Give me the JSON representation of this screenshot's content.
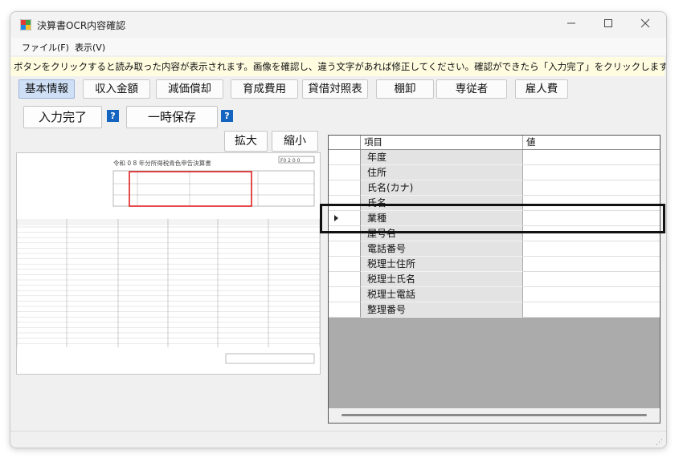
{
  "window": {
    "title": "決算書OCR内容確認"
  },
  "menu": [
    "ファイル(F)",
    "表示(V)"
  ],
  "instruction": "ボタンをクリックすると読み取った内容が表示されます。画像を確認し、違う文字があれば修正してください。確認ができたら「入力完了」をクリックします。",
  "tabs": [
    {
      "label": "基本情報",
      "active": true
    },
    {
      "label": "収入金額"
    },
    {
      "label": "減価償却"
    },
    {
      "label": "育成費用"
    },
    {
      "label": "貸借対照表"
    },
    {
      "label": "棚卸"
    },
    {
      "label": "専従者"
    },
    {
      "label": "雇人費"
    }
  ],
  "actions": {
    "complete": "入力完了",
    "save": "一時保存",
    "help": "?"
  },
  "zoom": {
    "in": "拡大",
    "out": "縮小"
  },
  "document": {
    "heading": "令和 0 8 年分所得税青色申告決算書",
    "page_number": "F0 2 0 0"
  },
  "grid": {
    "columns": [
      "項目",
      "値"
    ],
    "rows": [
      {
        "item": "年度",
        "value": ""
      },
      {
        "item": "住所",
        "value": ""
      },
      {
        "item": "氏名(カナ)",
        "value": ""
      },
      {
        "item": "氏名",
        "value": ""
      },
      {
        "item": "業種",
        "value": "",
        "current": true
      },
      {
        "item": "屋号名",
        "value": ""
      },
      {
        "item": "電話番号",
        "value": ""
      },
      {
        "item": "税理士住所",
        "value": ""
      },
      {
        "item": "税理士氏名",
        "value": ""
      },
      {
        "item": "税理士電話",
        "value": ""
      },
      {
        "item": "整理番号",
        "value": ""
      }
    ]
  },
  "colors": {
    "help_badge": "#1565c0",
    "active_tab": "#cfe0f6",
    "instruction_bg": "#fffce0",
    "form_highlight": "#e02020"
  }
}
